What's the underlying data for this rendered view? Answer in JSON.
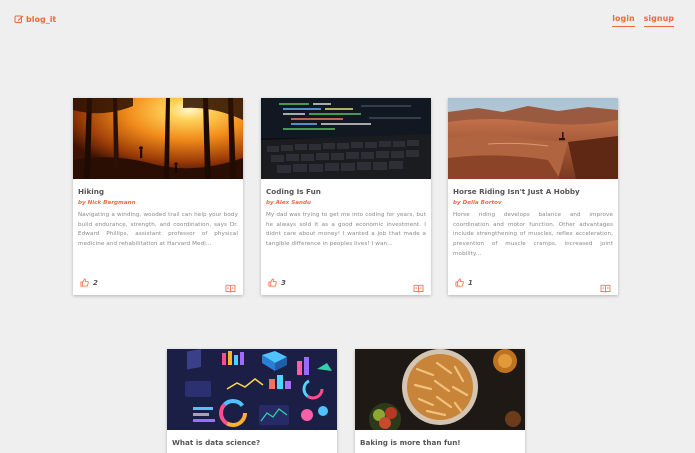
{
  "brand": {
    "name": "blog_it",
    "icon": "edit-icon",
    "accent": "#ee6a3c"
  },
  "nav": {
    "login": "login",
    "signup": "signup"
  },
  "posts": [
    {
      "title": "Hiking",
      "author": "by Nick Bergmann",
      "excerpt": "Navigating a winding, wooded trail can help your body build endurance, strength, and coordination, says Dr. Edward Phillips, assistant professor of physical medicine and rehabilitation at Harvard Medi...",
      "likes": "2",
      "image": "forest-sunset-hikers"
    },
    {
      "title": "Coding Is Fun",
      "author": "by Alex Sandu",
      "excerpt": "My dad was trying to get me into coding for years, but he always sold it as a good economic investment. I didnt care about money! I wanted a job that made a tangible difference in peoples lives! I wan...",
      "likes": "3",
      "image": "laptop-code"
    },
    {
      "title": "Horse Riding Isn't Just A Hobby",
      "author": "by Delia Bortov",
      "excerpt": "Horse riding develops balance and improve coordination and motor function. Other advantages include strengthening of muscles, reflex acceleration, prevention of muscle cramps, increased joint mobility...",
      "likes": "1",
      "image": "desert-canyon-rider"
    },
    {
      "title": "What is data science?",
      "author": "",
      "excerpt": "",
      "likes": "",
      "image": "data-visualization"
    },
    {
      "title": "Baking is more than fun!",
      "author": "",
      "excerpt": "",
      "likes": "",
      "image": "baked-pie"
    }
  ]
}
